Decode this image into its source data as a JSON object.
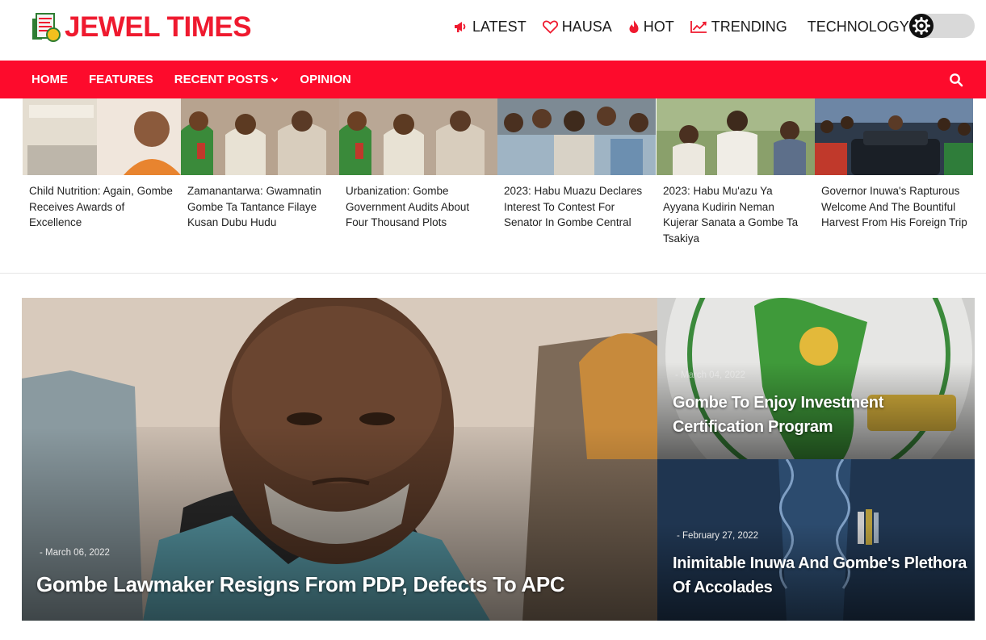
{
  "brand": {
    "name": "JEWEL TIMES",
    "accent": "#fd0b2c",
    "logo_color": "#ef1a2f"
  },
  "topnav": [
    {
      "label": "LATEST",
      "icon": "megaphone-icon"
    },
    {
      "label": "HAUSA",
      "icon": "heart-icon"
    },
    {
      "label": "HOT",
      "icon": "flame-icon"
    },
    {
      "label": "TRENDING",
      "icon": "trending-chart-icon"
    },
    {
      "label": "TECHNOLOGY",
      "icon": ""
    }
  ],
  "theme_toggle": {
    "icon": "gear-icon"
  },
  "mainnav": {
    "items": [
      {
        "label": "HOME"
      },
      {
        "label": "FEATURES"
      },
      {
        "label": "RECENT POSTS",
        "icon": "chevron-down-icon"
      },
      {
        "label": "OPINION"
      }
    ],
    "search_icon": "search-icon"
  },
  "strip": [
    {
      "title": "Child Nutrition: Again, Gombe Receives Awards of Excellence"
    },
    {
      "title": "Zamanantarwa: Gwamnatin Gombe Ta Tantance Filaye Kusan Dubu Hudu"
    },
    {
      "title": "Urbanization: Gombe Government Audits About Four Thousand Plots"
    },
    {
      "title": "2023: Habu Muazu Declares Interest To Contest For Senator In Gombe Central"
    },
    {
      "title": "2023: Habu Mu'azu Ya Ayyana Kudirin Neman Kujerar Sanata a Gombe Ta Tsakiya"
    },
    {
      "title": "Governor Inuwa's Rapturous Welcome And The Bountiful Harvest From His Foreign Trip"
    }
  ],
  "featured": {
    "main": {
      "date": "- March 06, 2022",
      "title": "Gombe Lawmaker Resigns From PDP, Defects To APC"
    },
    "side": [
      {
        "date": "- March 04, 2022",
        "title": "Gombe To Enjoy Investment Certification Program"
      },
      {
        "date": "- February 27, 2022",
        "title": "Inimitable Inuwa And Gombe's Plethora Of Accolades"
      }
    ]
  }
}
